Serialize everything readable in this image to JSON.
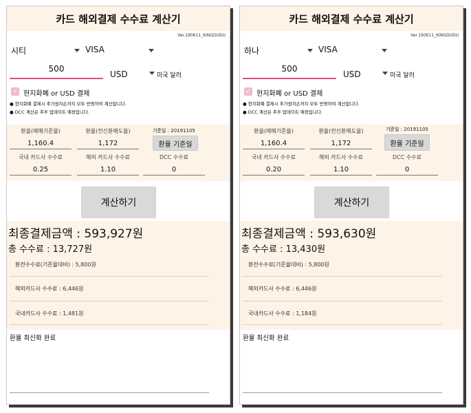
{
  "app": {
    "title": "카드 해외결제 수수료 계산기",
    "version": "Ver.190611_KINGDUDU"
  },
  "screens": [
    {
      "bank": "시티",
      "brand": "VISA",
      "amount": "500",
      "currency": "USD",
      "currency_name": "미국 달러",
      "local_currency_checkbox": "현지화폐 or USD 결제",
      "notes": [
        "현지화폐 결제시 추가원자손까지 모두 반영하여 계산합니다.",
        "DCC 계산은 추후 업데이트 예정입니다."
      ],
      "rate_date": "기준일 : 20191105",
      "rate_base_label": "환율(매매기준율)",
      "rate_base_value": "1,160.4",
      "rate_tt_label": "환율(전신환매도율)",
      "rate_tt_value": "1,172",
      "rate_date_button": "환율 기준일",
      "domestic_fee_label": "국내 카드사 수수료",
      "domestic_fee_value": "0.25",
      "foreign_fee_label": "해외 카드사 수수료",
      "foreign_fee_value": "1.10",
      "dcc_fee_label": "DCC 수수료",
      "dcc_fee_value": "0",
      "calculate_button": "계산하기",
      "final_amount": "최종결제금액 :  593,927원",
      "total_fee": "총 수수료 :  13,727원",
      "exchange_fee": "환전수수료(기준율대비) : 5,800원",
      "foreign_card_fee": "해외카드사 수수료 : 6,446원",
      "domestic_card_fee": "국내카드사 수수료 : 1,481원",
      "status": "환율 최신화 완료"
    },
    {
      "bank": "하나",
      "brand": "VISA",
      "amount": "500",
      "currency": "USD",
      "currency_name": "미국 달러",
      "local_currency_checkbox": "현지화폐 or USD 결제",
      "notes": [
        "현지화폐 결제시 추가원자손까지 모두 반영하여 계산합니다.",
        "DCC 계산은 추후 업데이트 예정입니다."
      ],
      "rate_date": "기준일 : 20191105",
      "rate_base_label": "환율(매매기준율)",
      "rate_base_value": "1,160.4",
      "rate_tt_label": "환율(전신환매도율)",
      "rate_tt_value": "1,172",
      "rate_date_button": "환율 기준일",
      "domestic_fee_label": "국내 카드사 수수료",
      "domestic_fee_value": "0.20",
      "foreign_fee_label": "해외 카드사 수수료",
      "foreign_fee_value": "1.10",
      "dcc_fee_label": "DCC 수수료",
      "dcc_fee_value": "0",
      "calculate_button": "계산하기",
      "final_amount": "최종결제금액 :  593,630원",
      "total_fee": "총 수수료 :  13,430원",
      "exchange_fee": "환전수수료(기준율대비) : 5,800원",
      "foreign_card_fee": "해외카드사 수수료 : 6,446원",
      "domestic_card_fee": "국내카드사 수수료 : 1,184원",
      "status": "환율 최신화 완료"
    }
  ],
  "colors": {
    "panel_bg": "#fdf3e7",
    "accent_pink": "#e54b8a",
    "checkbox_pink": "#f2b9cf",
    "button_gray": "#d9d9d9"
  }
}
